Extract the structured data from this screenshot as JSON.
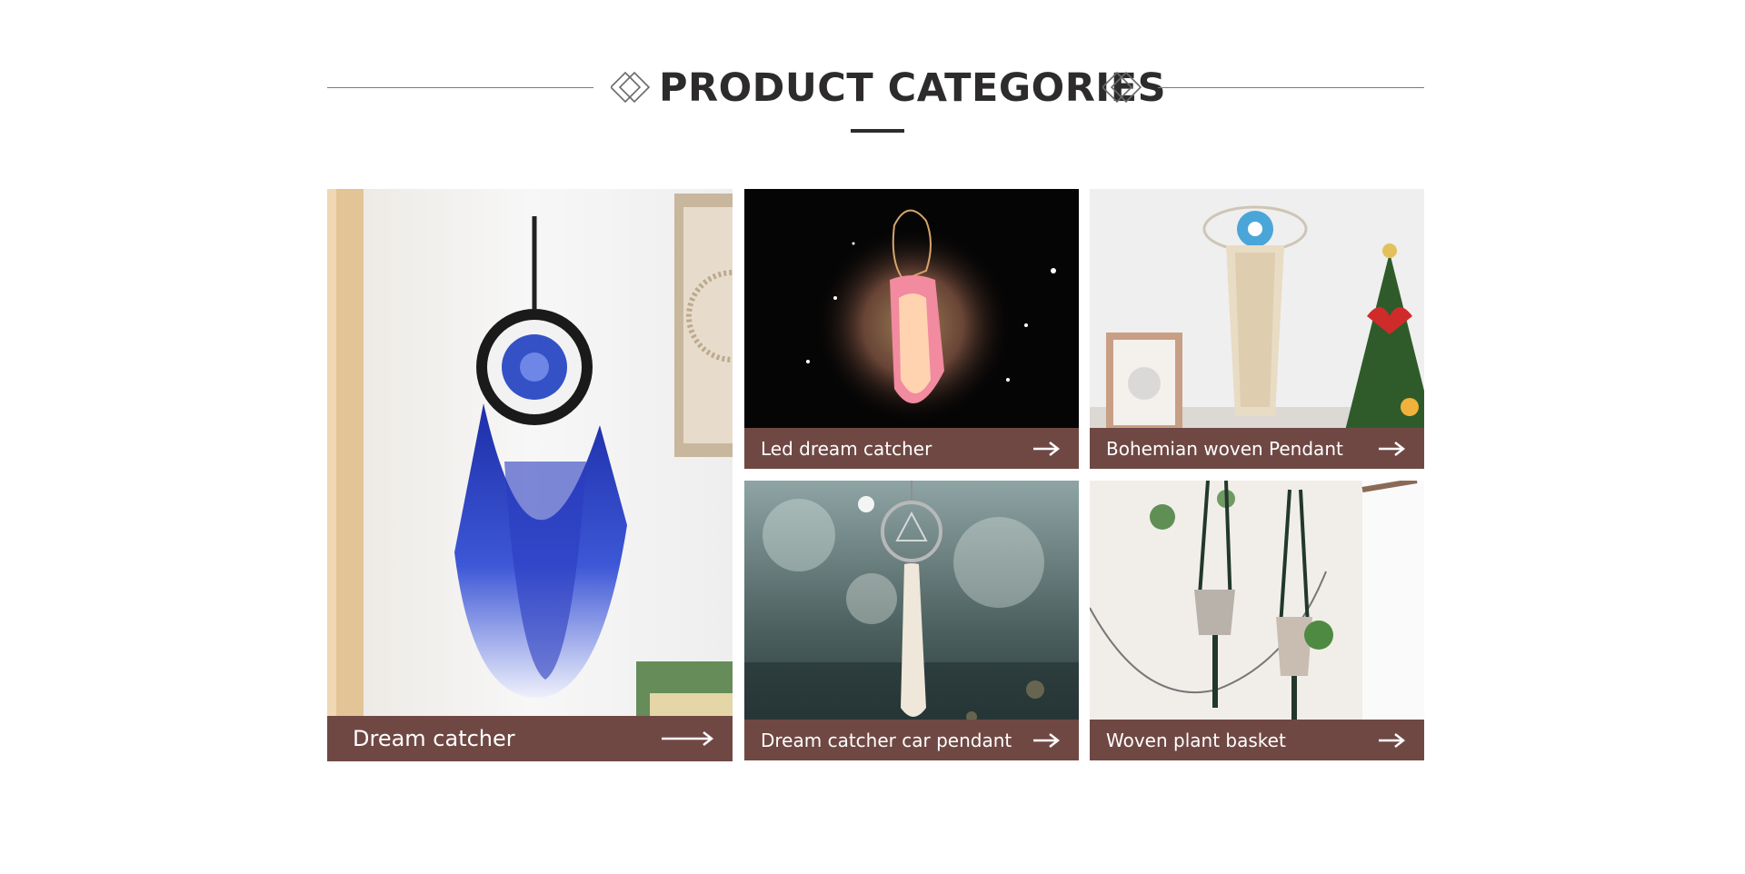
{
  "section": {
    "title": "PRODUCT CATEGORIES"
  },
  "categories": [
    {
      "label": "Dream catcher",
      "arrow_icon": "long-arrow-right-icon"
    },
    {
      "label": "Led dream catcher",
      "arrow_icon": "arrow-right-icon"
    },
    {
      "label": "Bohemian woven Pendant",
      "arrow_icon": "arrow-right-icon"
    },
    {
      "label": "Dream catcher car pendant",
      "arrow_icon": "arrow-right-icon"
    },
    {
      "label": "Woven plant basket",
      "arrow_icon": "arrow-right-icon"
    }
  ],
  "colors": {
    "bar": "#6f4844",
    "title": "#2d2b2b",
    "line": "#7a7a7a"
  }
}
